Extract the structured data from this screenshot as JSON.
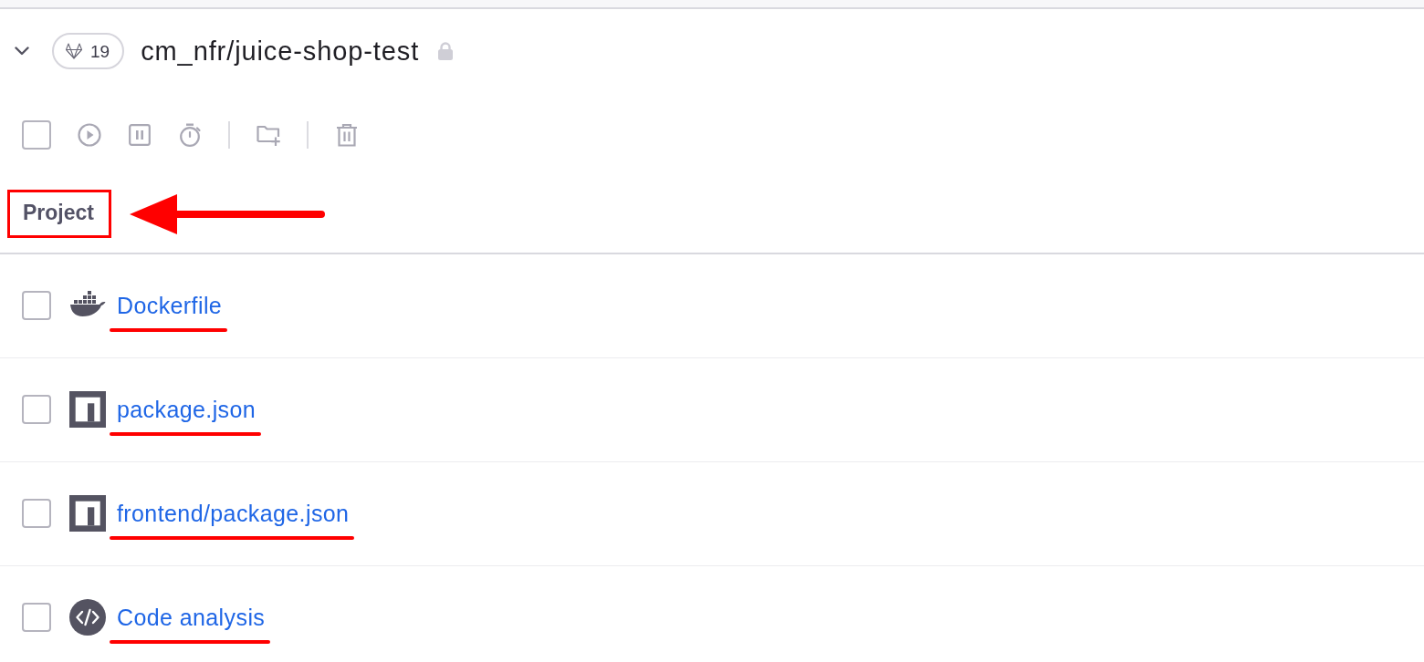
{
  "header": {
    "expanded": true,
    "badge": {
      "count": "19"
    },
    "title": "cm_nfr/juice-shop-test",
    "locked": true
  },
  "toolbar": {
    "select_all": {
      "checked": false
    },
    "actions": [
      {
        "kind": "play",
        "disabled": true
      },
      {
        "kind": "pause",
        "disabled": true
      },
      {
        "kind": "timer",
        "disabled": true
      },
      {
        "kind": "divider"
      },
      {
        "kind": "new-folder",
        "disabled": true
      },
      {
        "kind": "divider"
      },
      {
        "kind": "delete",
        "disabled": true
      }
    ]
  },
  "column_header": {
    "label": "Project",
    "boxed": true,
    "arrow": true
  },
  "rows": [
    {
      "kind": "docker",
      "name": "Dockerfile",
      "checked": false,
      "underlined": true
    },
    {
      "kind": "npm",
      "name": "package.json",
      "checked": false,
      "underlined": true
    },
    {
      "kind": "npm",
      "name": "frontend/package.json",
      "checked": false,
      "underlined": true
    },
    {
      "kind": "code",
      "name": "Code analysis",
      "checked": false,
      "underlined": true
    }
  ]
}
